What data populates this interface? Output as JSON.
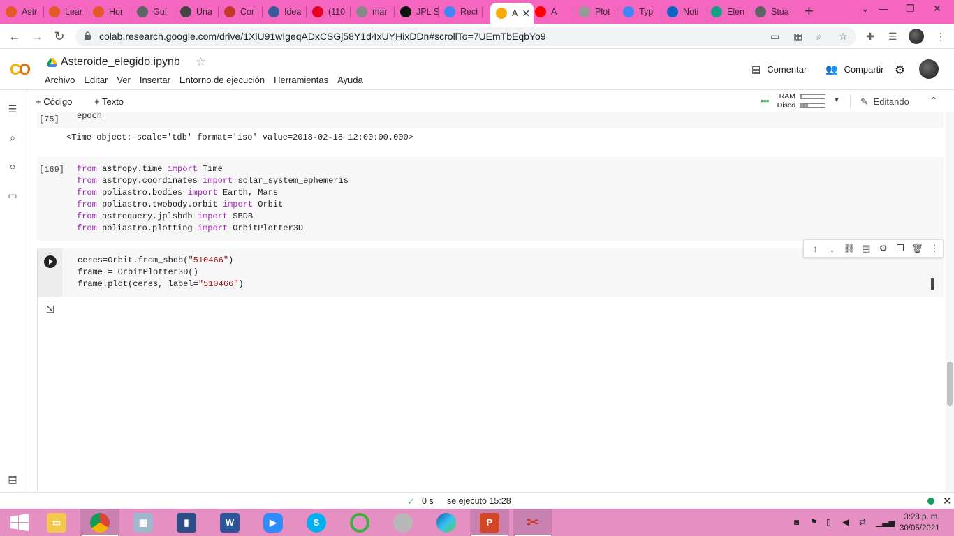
{
  "browser": {
    "tabs": [
      {
        "label": "Astr",
        "icon": "lottery-icon"
      },
      {
        "label": "Lear",
        "icon": "lottery-icon"
      },
      {
        "label": "Hor",
        "icon": "lottery-icon"
      },
      {
        "label": "Guí",
        "icon": "globe-icon"
      },
      {
        "label": "Una",
        "icon": "wikipedia-icon"
      },
      {
        "label": "Cor",
        "icon": "star-burst-icon"
      },
      {
        "label": "Idea",
        "icon": "ideas-icon"
      },
      {
        "label": "(110",
        "icon": "pinterest-icon"
      },
      {
        "label": "mar",
        "icon": "compass-icon"
      },
      {
        "label": "JPL S",
        "icon": "jpl-icon"
      },
      {
        "label": "Reci",
        "icon": "google-assistant-icon"
      },
      {
        "label": "A",
        "icon": "colab-icon",
        "active": true
      },
      {
        "label": "A",
        "icon": "youtube-icon"
      },
      {
        "label": "Plot",
        "icon": "document-icon"
      },
      {
        "label": "Typ",
        "icon": "google-icon"
      },
      {
        "label": "Noti",
        "icon": "linkedin-icon"
      },
      {
        "label": "Elen",
        "icon": "refresh-circle-icon"
      },
      {
        "label": "Stua",
        "icon": "globe-icon"
      }
    ],
    "url": "colab.research.google.com/drive/1XiU91wIgeqADxCSGj58Y1d4xUYHixDDn#scrollTo=7UEmTbEqbYo9"
  },
  "colab": {
    "notebook_title": "Asteroide_elegido.ipynb",
    "menu": [
      "Archivo",
      "Editar",
      "Ver",
      "Insertar",
      "Entorno de ejecución",
      "Herramientas",
      "Ayuda"
    ],
    "comment_label": "Comentar",
    "share_label": "Compartir",
    "add_code_label": "+ Código",
    "add_text_label": "+ Texto",
    "ram_label": "RAM",
    "disk_label": "Disco",
    "ram_usage": 0.08,
    "disk_usage": 0.3,
    "editing_label": "Editando"
  },
  "cells": {
    "cell_75": {
      "number": "[75]",
      "code": "epoch",
      "output": "<Time object: scale='tdb' format='iso' value=2018-02-18 12:00:00.000>"
    },
    "cell_169": {
      "number": "[169]",
      "lines": [
        {
          "kw1": "from",
          "mod": " astropy.time ",
          "kw2": "import",
          "name": " Time"
        },
        {
          "kw1": "from",
          "mod": " astropy.coordinates ",
          "kw2": "import",
          "name": " solar_system_ephemeris"
        },
        {
          "kw1": "from",
          "mod": " poliastro.bodies ",
          "kw2": "import",
          "name": " Earth, Mars"
        },
        {
          "kw1": "from",
          "mod": " poliastro.twobody.orbit ",
          "kw2": "import",
          "name": " Orbit"
        },
        {
          "kw1": "from",
          "mod": " astroquery.jplsbdb ",
          "kw2": "import",
          "name": " SBDB"
        },
        {
          "kw1": "from",
          "mod": " poliastro.plotting ",
          "kw2": "import",
          "name": " OrbitPlotter3D"
        }
      ]
    },
    "cell_active": {
      "line1_a": "ceres=Orbit.from_sbdb(",
      "line1_str": "\"510466\"",
      "line1_b": ")",
      "line2": "frame = OrbitPlotter3D()",
      "line3_a": "frame.plot(ceres, label=",
      "line3_str": "\"510466\"",
      "line3_b": ")"
    }
  },
  "status": {
    "duration": "0 s",
    "executed": "se ejecutó 15:28"
  },
  "taskbar": {
    "time": "3:28 p. m.",
    "date": "30/05/2021"
  },
  "colors": {
    "tabstrip": "#f466c0",
    "taskbar": "#e58fc3",
    "keyword": "#9c27b0",
    "string": "#a31515",
    "runtime_ok": "#34a853"
  }
}
